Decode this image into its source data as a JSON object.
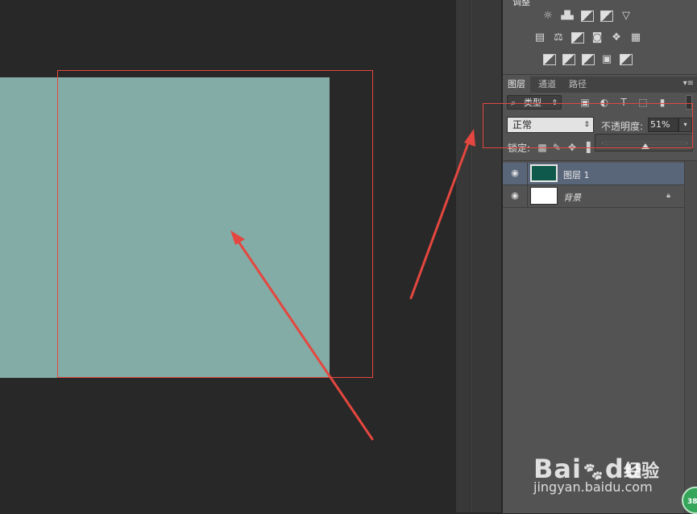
{
  "adjustments": {
    "title": "调整",
    "row1": [
      "sun-icon",
      "levels-icon",
      "curves-icon",
      "exposure-icon",
      "triangle-icon"
    ],
    "row2": [
      "vibrance-icon",
      "balance-icon",
      "bw-icon",
      "camera-icon",
      "mixer-icon",
      "grid-icon"
    ],
    "row3": [
      "invert-icon",
      "posterize-icon",
      "threshold-icon",
      "selective-icon",
      "gradient-icon"
    ]
  },
  "tabs": [
    {
      "label": "图层",
      "active": true
    },
    {
      "label": "通道",
      "active": false
    },
    {
      "label": "路径",
      "active": false
    }
  ],
  "panel_menu": "▾≡",
  "filter": {
    "search_glyph": "⌕",
    "label": "类型",
    "arrow": "⇕"
  },
  "blend": {
    "mode": "正常",
    "arrow": "⇕"
  },
  "opacity": {
    "label": "不透明度:",
    "value": "51%",
    "fraction": 0.51,
    "drop_arrow": "▾"
  },
  "lock": {
    "label": "锁定:"
  },
  "layers": [
    {
      "name": "图层 1",
      "selected": true,
      "thumb": "green",
      "locked": false
    },
    {
      "name": "背景",
      "selected": false,
      "thumb": "white",
      "locked": true
    }
  ],
  "colors": {
    "canvas_fill": "#83aca6",
    "layer1_fill": "#0e594b",
    "annotation": "#e4473f",
    "selected_row": "#596579"
  },
  "watermark": {
    "brand": "Bai",
    "brand2": "du",
    "sub": "经验",
    "url": "jingyan.baidu.com",
    "badge": "38"
  }
}
